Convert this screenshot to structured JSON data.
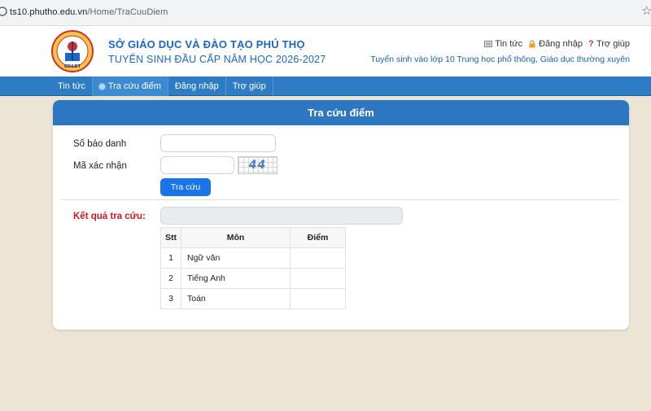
{
  "browser": {
    "url_host": "ts10.phutho.edu.vn",
    "url_path": "/Home/TraCuuDiem"
  },
  "header": {
    "title_line1": "SỞ GIÁO DỤC VÀ ĐÀO TẠO PHÚ THỌ",
    "title_line2": "TUYỂN SINH ĐẦU CẤP NĂM HỌC 2026-2027",
    "toplinks": {
      "news": "Tin tức",
      "login": "Đăng nhập",
      "help": "Trợ giúp"
    },
    "subtitle": "Tuyển sinh vào lớp 10 Trung học phổ thông, Giáo dục thường xuyên",
    "colors": {
      "brand_blue": "#1a67c8",
      "nav_blue": "#2d7cc4"
    }
  },
  "nav": {
    "items": [
      {
        "label": "Tin tức",
        "active": false
      },
      {
        "label": "Tra cứu điểm",
        "active": true,
        "icon": "dot-icon"
      },
      {
        "label": "Đăng nhập",
        "active": false
      },
      {
        "label": "Trợ giúp",
        "active": false
      }
    ]
  },
  "form": {
    "heading": "Tra cứu điểm",
    "sbd_label": "Số báo danh",
    "sbd_value": "",
    "captcha_label": "Mã xác nhận",
    "captcha_value": "",
    "captcha_text": "44",
    "submit_label": "Tra cứu",
    "result_label": "Kết quả tra cứu:",
    "result_value": ""
  },
  "scores": {
    "columns": [
      "Stt",
      "Môn",
      "Điểm"
    ],
    "rows": [
      {
        "stt": "1",
        "mon": "Ngữ văn",
        "diem": ""
      },
      {
        "stt": "2",
        "mon": "Tiếng Anh",
        "diem": ""
      },
      {
        "stt": "3",
        "mon": "Toán",
        "diem": ""
      }
    ]
  }
}
